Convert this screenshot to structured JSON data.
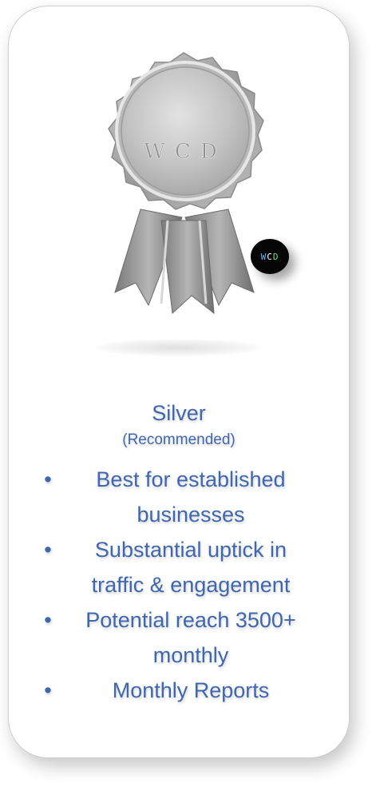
{
  "medal": {
    "engraving": "WCD",
    "colors": {
      "rim": "#a9a9a9",
      "face": "#c8c8c8",
      "ribbon": "#8f8f8f"
    }
  },
  "badge": {
    "letters": [
      "W",
      "C",
      "D"
    ],
    "colors": [
      "#6fb3ff",
      "#ffffff",
      "#6cdc6c"
    ],
    "background": "#060606"
  },
  "plan": {
    "title": "Silver",
    "subtitle": "(Recommended)",
    "features": [
      "Best for established businesses",
      "Substantial uptick in traffic & engagement",
      "Potential reach 3500+ monthly",
      "Monthly Reports"
    ]
  },
  "theme": {
    "accent": "#3f67b0"
  }
}
